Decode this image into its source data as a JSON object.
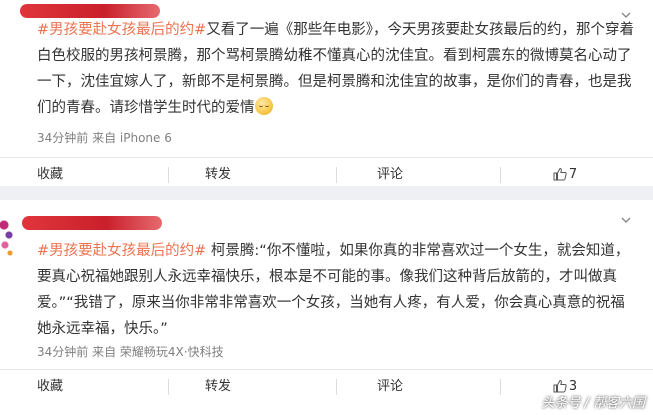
{
  "posts": [
    {
      "hashtag": "#男孩要赴女孩最后的约#",
      "body": "又看了一遍《那些年电影》，今天男孩要赴女孩最后的约，那个穿着白色校服的男孩柯景腾，那个骂柯景腾幼稚不懂真心的沈佳宜。看到柯震东的微博莫名心动了一下，沈佳宜嫁人了，新郎不是柯景腾。但是柯景腾和沈佳宜的故事，是你们的青春，也是我们的青春。请珍惜学生时代的爱情",
      "emoji": "sleepy-face-emoji",
      "meta": "34分钟前 来自 iPhone 6",
      "actions": {
        "favorite": "收藏",
        "repost": "转发",
        "comment": "评论",
        "likes": "7"
      }
    },
    {
      "hashtag": "#男孩要赴女孩最后的约#",
      "body": " 柯景腾:“你不懂啦，如果你真的非常喜欢过一个女生，就会知道，要真心祝福她跟别人永远幸福快乐，根本是不可能的事。像我们这种背后放箭的，才叫做真爱。”“我错了，原来当你非常非常喜欢一个女孩，当她有人疼，有人爱，你会真心真意的祝福她永远幸福，快乐。”",
      "meta": "34分钟前 来自 荣耀畅玩4X·快科技",
      "actions": {
        "favorite": "收藏",
        "repost": "转发",
        "comment": "评论",
        "likes": "3"
      }
    }
  ],
  "watermark": "头条号 / 帮客六国",
  "colors": {
    "hashtag": "#eb7350",
    "text": "#333333",
    "meta": "#808080",
    "redaction": "#d62b33"
  }
}
